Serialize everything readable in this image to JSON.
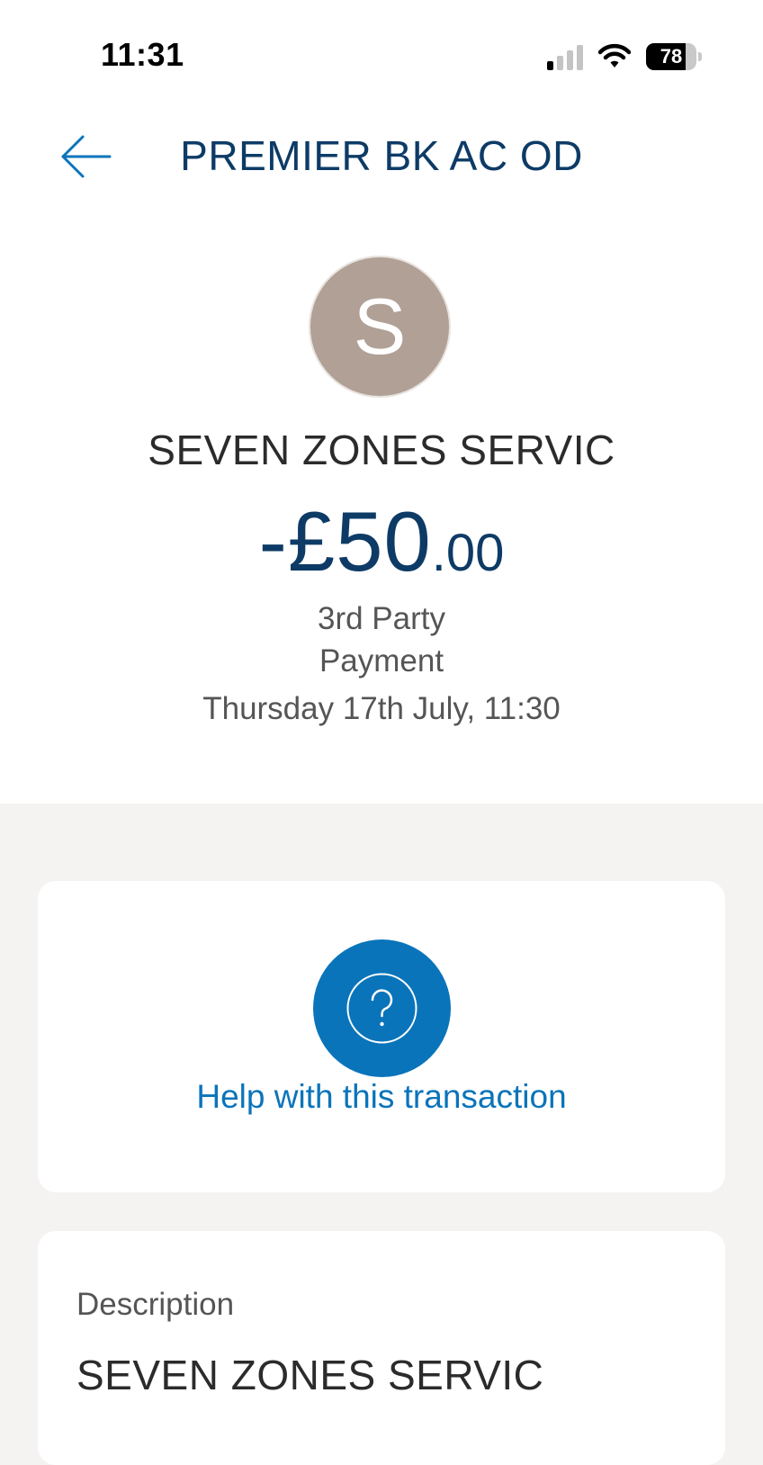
{
  "status_bar": {
    "time": "11:31",
    "battery": "78",
    "battery_level": 0.78
  },
  "header": {
    "title": "PREMIER BK AC OD"
  },
  "transaction": {
    "avatar_letter": "S",
    "avatar_color": "#b0a095",
    "payee": "SEVEN ZONES SERVIC",
    "amount_main": "-£50",
    "amount_decimal": ".00",
    "type_line1": "3rd Party",
    "type_line2": "Payment",
    "date": "Thursday 17th July, 11:30"
  },
  "help": {
    "label": "Help with this transaction"
  },
  "details": {
    "description_label": "Description",
    "description_value": "SEVEN ZONES SERVIC"
  },
  "colors": {
    "brand_blue": "#0a74ba",
    "navy_text": "#0d3b66",
    "background": "#f4f3f1"
  },
  "icons": [
    "back-arrow-icon",
    "signal-icon",
    "wifi-icon",
    "battery-icon",
    "help-question-icon"
  ]
}
